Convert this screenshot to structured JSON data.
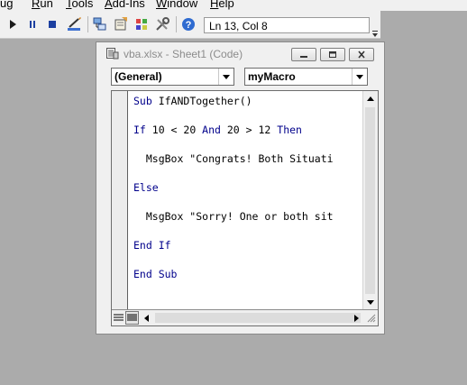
{
  "menubar": {
    "items": [
      {
        "label": "ug",
        "accel": ""
      },
      {
        "label": "Run",
        "accel": "R"
      },
      {
        "label": "Tools",
        "accel": "T"
      },
      {
        "label": "Add-Ins",
        "accel": "A"
      },
      {
        "label": "Window",
        "accel": "W"
      },
      {
        "label": "Help",
        "accel": "H"
      }
    ]
  },
  "toolbar": {
    "status": "Ln 13, Col 8",
    "icons": [
      "run-icon",
      "break-icon",
      "reset-icon",
      "design-mode-icon",
      "project-explorer-icon",
      "properties-icon",
      "object-browser-icon",
      "toolbox-icon",
      "help-icon"
    ]
  },
  "window": {
    "title": "vba.xlsx - Sheet1 (Code)",
    "object_combo": "(General)",
    "procedure_combo": "myMacro"
  },
  "code": {
    "lines": [
      {
        "kw": "Sub ",
        "rest": "IfANDTogether()"
      },
      {
        "kw": "If ",
        "rest": "10 < 20 ",
        "kw2": "And ",
        "rest2": "20 > 12 ",
        "kw3": "Then"
      },
      {
        "rest": "  MsgBox \"Congrats! Both Situati"
      },
      {
        "kw": "Else"
      },
      {
        "rest": "  MsgBox \"Sorry! One or both sit"
      },
      {
        "kw": "End If"
      },
      {
        "kw": "End Sub"
      }
    ]
  },
  "colors": {
    "keyword": "#00008b",
    "background": "#ababab",
    "chrome": "#f0f0f0"
  }
}
